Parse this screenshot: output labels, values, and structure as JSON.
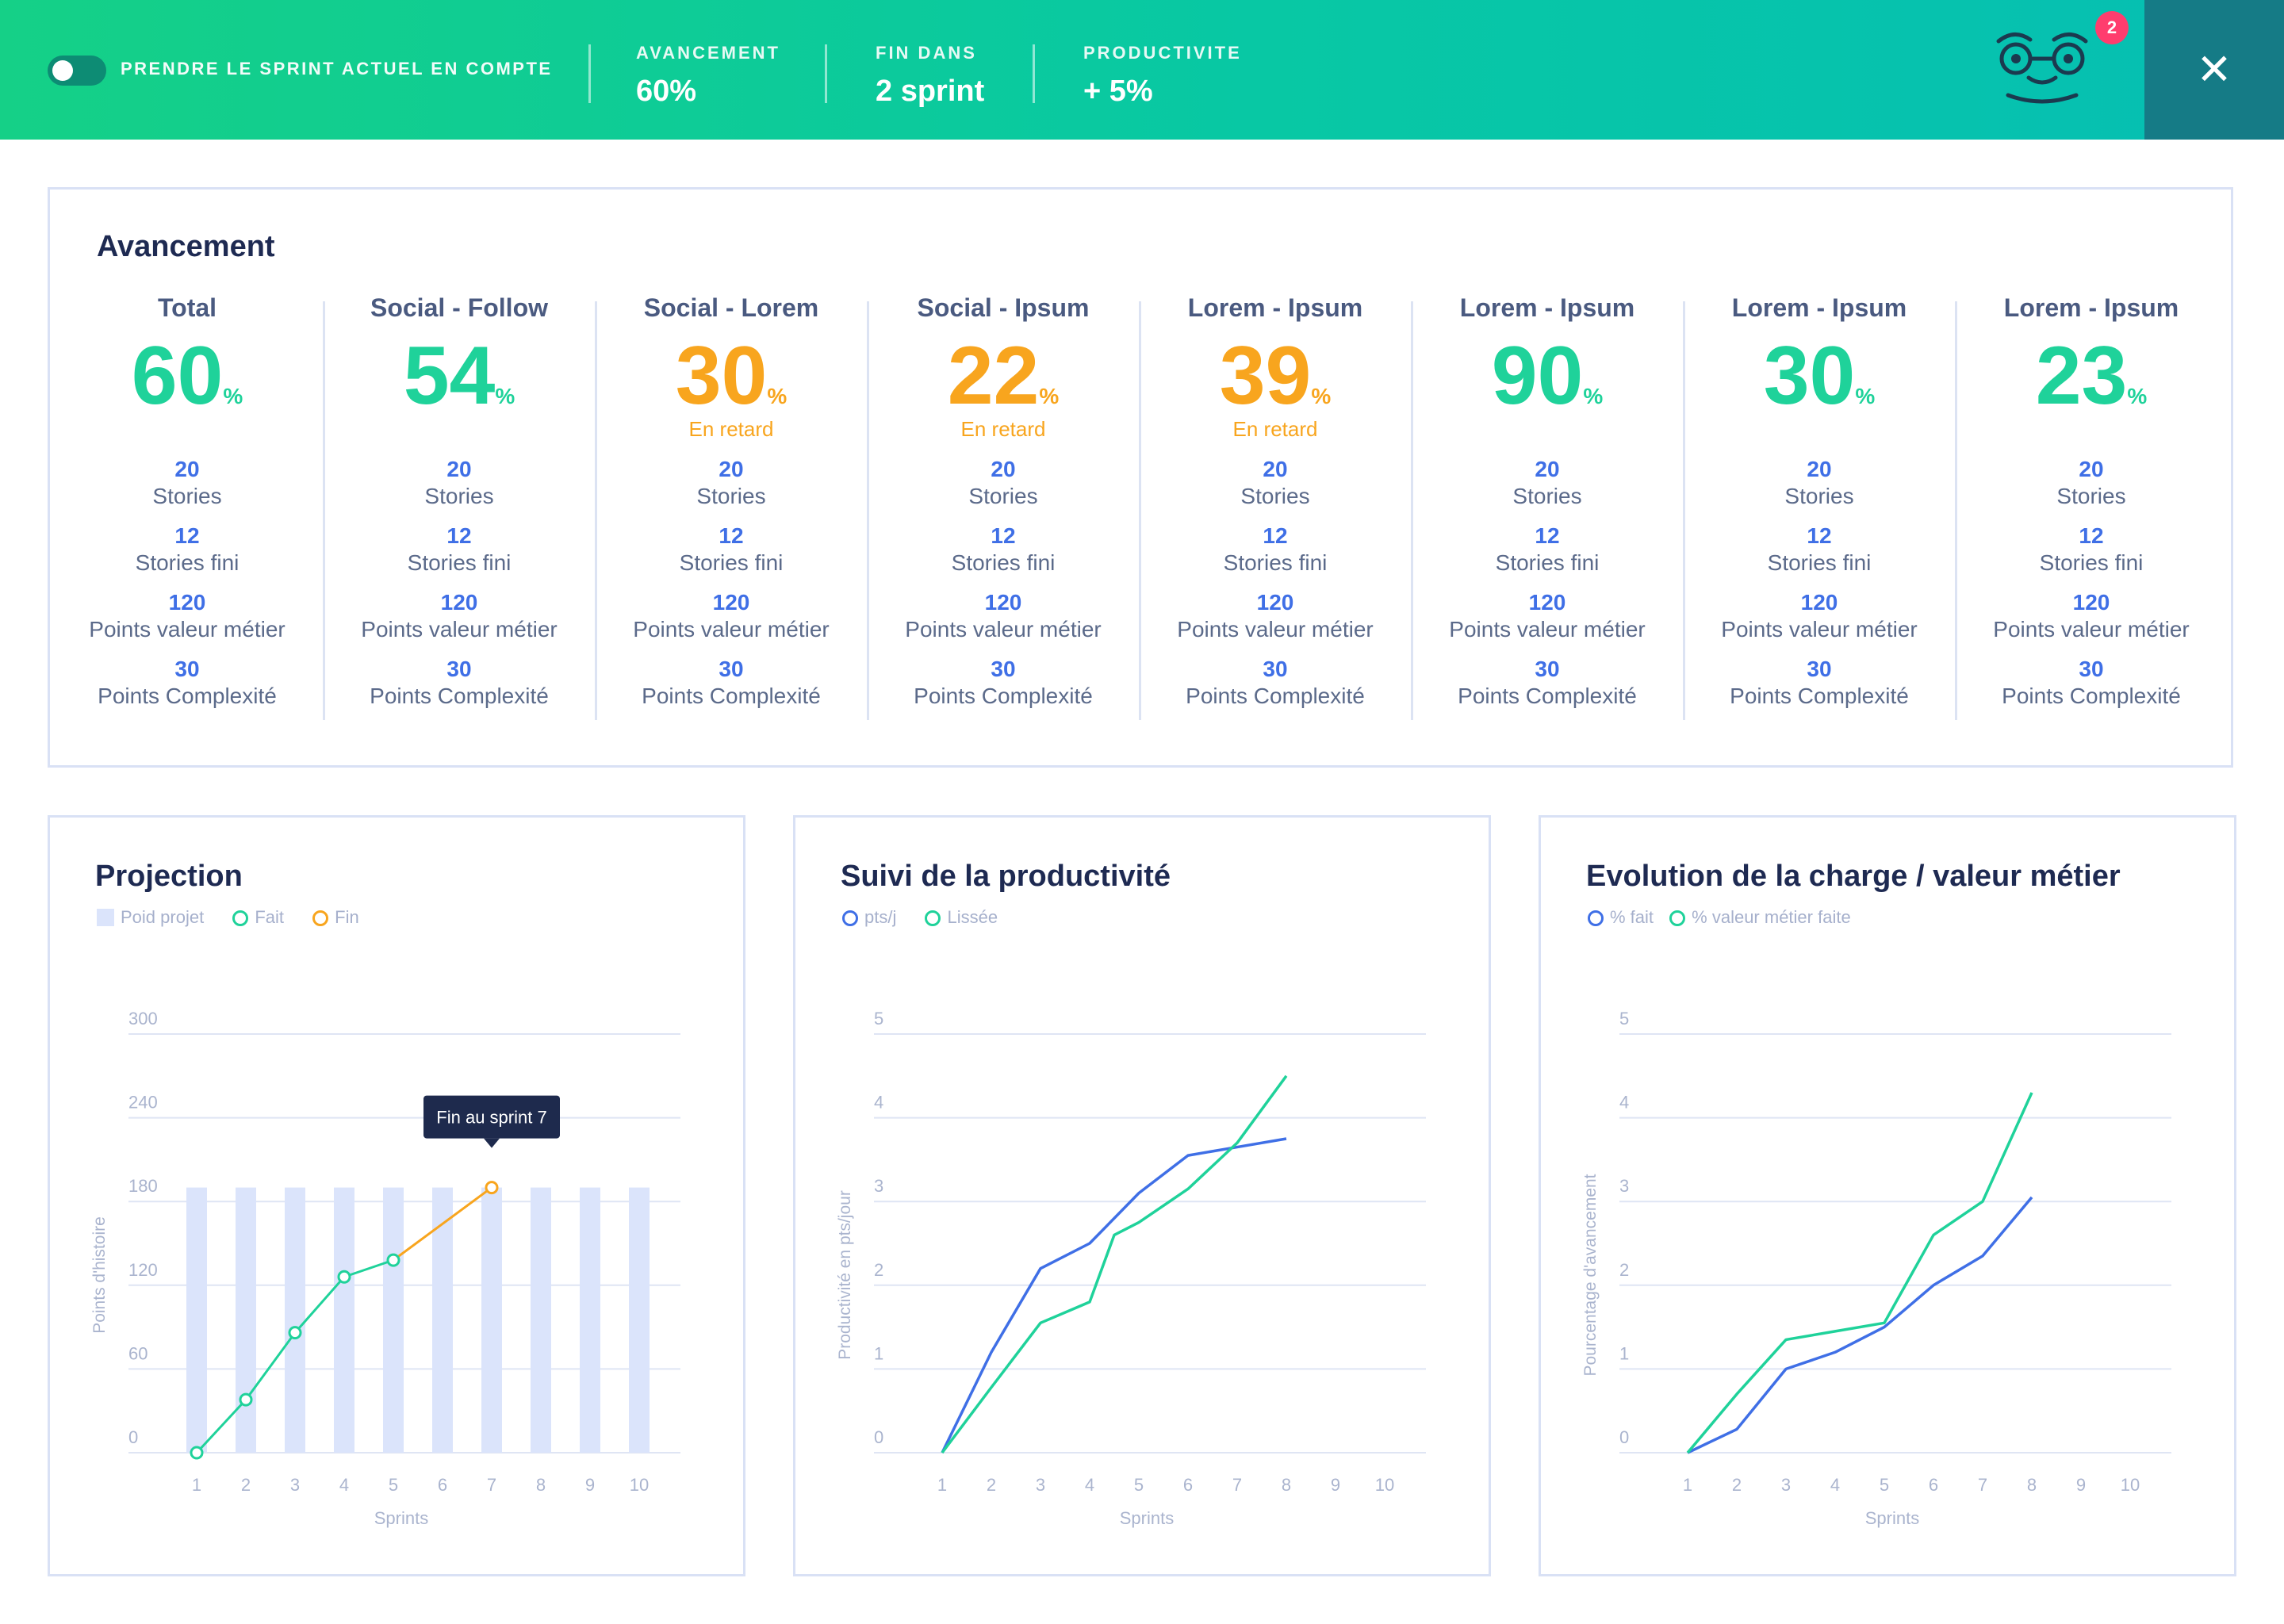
{
  "topbar": {
    "toggle_label": "PRENDRE LE SPRINT ACTUEL EN COMPTE",
    "stats": [
      {
        "label": "AVANCEMENT",
        "value": "60%"
      },
      {
        "label": "FIN DANS",
        "value": "2 sprint"
      },
      {
        "label": "PRODUCTIVITE",
        "value": "+ 5%"
      }
    ],
    "notifications": "2",
    "close": "✕"
  },
  "progress": {
    "title": "Avancement",
    "columns": [
      {
        "name": "Total",
        "pct": "60",
        "late": "",
        "status": "green"
      },
      {
        "name": "Social - Follow",
        "pct": "54",
        "late": "",
        "status": "green"
      },
      {
        "name": "Social - Lorem",
        "pct": "30",
        "late": "En retard",
        "status": "orange"
      },
      {
        "name": "Social - Ipsum",
        "pct": "22",
        "late": "En retard",
        "status": "orange"
      },
      {
        "name": "Lorem - Ipsum",
        "pct": "39",
        "late": "En retard",
        "status": "orange"
      },
      {
        "name": "Lorem - Ipsum",
        "pct": "90",
        "late": "",
        "status": "green"
      },
      {
        "name": "Lorem - Ipsum",
        "pct": "30",
        "late": "",
        "status": "green"
      },
      {
        "name": "Lorem - Ipsum",
        "pct": "23",
        "late": "",
        "status": "green"
      }
    ],
    "pct_unit": "%",
    "metrics": [
      {
        "value": "20",
        "label": "Stories"
      },
      {
        "value": "12",
        "label": "Stories fini"
      },
      {
        "value": "120",
        "label": "Points valeur métier"
      },
      {
        "value": "30",
        "label": "Points Complexité"
      }
    ]
  },
  "colors": {
    "green": "#1fd29a",
    "orange": "#f8a51e",
    "blue": "#3f6fe6",
    "bar": "#dbe4fb"
  },
  "chart_data": [
    {
      "type": "bar",
      "title": "Projection",
      "legend": [
        "Poid projet",
        "Fait",
        "Fin"
      ],
      "xlabel": "Sprints",
      "ylabel": "Points d'histoire",
      "x": [
        1,
        2,
        3,
        4,
        5,
        6,
        7,
        8,
        9,
        10
      ],
      "yticks": [
        "0",
        "60",
        "120",
        "180",
        "240",
        "300"
      ],
      "ylim": [
        0,
        300
      ],
      "bars": [
        190,
        190,
        190,
        190,
        190,
        190,
        190,
        190,
        190,
        190
      ],
      "fait": [
        0,
        38,
        86,
        126,
        138
      ],
      "fin": [
        {
          "x": 5,
          "y": 138
        },
        {
          "x": 7,
          "y": 190
        }
      ],
      "tooltip": "Fin au sprint 7"
    },
    {
      "type": "line",
      "title": "Suivi de la productivité",
      "legend": [
        "pts/j",
        "Lissée"
      ],
      "xlabel": "Sprints",
      "ylabel": "Productivité en pts/jour",
      "x": [
        1,
        2,
        3,
        4,
        5,
        6,
        7,
        8,
        9,
        10
      ],
      "yticks": [
        "0",
        "1",
        "2",
        "3",
        "4",
        "5"
      ],
      "ylim": [
        0,
        5
      ],
      "series": [
        {
          "name": "pts/j",
          "x": [
            1,
            2,
            3,
            4,
            5,
            6,
            7,
            8
          ],
          "values": [
            0,
            1.2,
            2.2,
            2.5,
            3.1,
            3.55,
            3.65,
            3.75
          ]
        },
        {
          "name": "Lissée",
          "x": [
            1,
            2,
            3,
            4,
            4.5,
            5,
            6,
            7,
            8
          ],
          "values": [
            0,
            0.78,
            1.55,
            1.8,
            2.6,
            2.75,
            3.15,
            3.7,
            4.5
          ]
        }
      ]
    },
    {
      "type": "line",
      "title": "Evolution de la charge / valeur métier",
      "legend": [
        "% fait",
        "% valeur métier faite"
      ],
      "xlabel": "Sprints",
      "ylabel": "Pourcentage d'avancement",
      "x": [
        1,
        2,
        3,
        4,
        5,
        6,
        7,
        8,
        9,
        10
      ],
      "yticks": [
        "0",
        "1",
        "2",
        "3",
        "4",
        "5"
      ],
      "ylim": [
        0,
        5
      ],
      "series": [
        {
          "name": "% fait",
          "x": [
            1,
            2,
            3,
            4,
            5,
            6,
            7,
            8
          ],
          "values": [
            0,
            0.28,
            1.0,
            1.2,
            1.5,
            2.0,
            2.35,
            3.05
          ]
        },
        {
          "name": "% valeur métier faite",
          "x": [
            1,
            2,
            3,
            4,
            5,
            6,
            7,
            8
          ],
          "values": [
            0,
            0.7,
            1.35,
            1.45,
            1.55,
            2.6,
            3.0,
            4.3
          ]
        }
      ]
    }
  ]
}
